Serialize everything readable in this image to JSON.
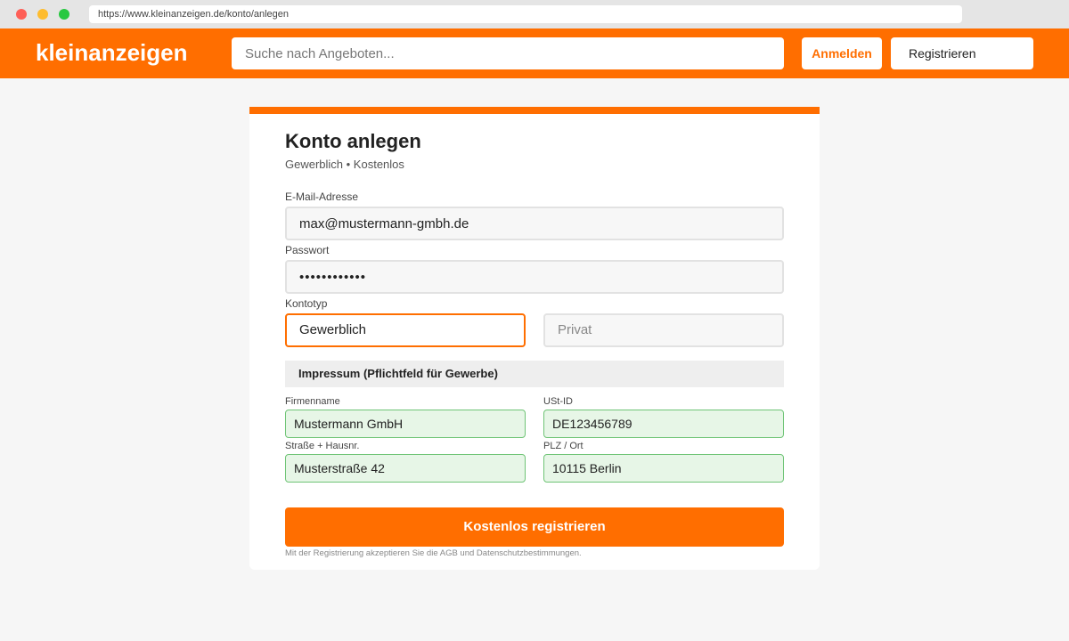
{
  "browser": {
    "url": "https://www.kleinanzeigen.de/konto/anlegen"
  },
  "header": {
    "logo": "kleinanzeigen",
    "search_placeholder": "Suche nach Angeboten...",
    "login_label": "Anmelden",
    "register_label": "Registrieren",
    "brand_color": "#ff6e00"
  },
  "form": {
    "title": "Konto anlegen",
    "subtitle": "Gewerblich • Kostenlos",
    "email": {
      "label": "E-Mail-Adresse",
      "value": "max@mustermann-gmbh.de"
    },
    "password": {
      "label": "Passwort",
      "value": "••••••••••••"
    },
    "account_type": {
      "label": "Kontotyp",
      "options": [
        "Gewerblich",
        "Privat"
      ],
      "selected": "Gewerblich"
    },
    "imprint": {
      "heading": "Impressum (Pflichtfeld für Gewerbe)",
      "company": {
        "label": "Firmenname",
        "value": "Mustermann GmbH"
      },
      "vat": {
        "label": "USt-ID",
        "value": "DE123456789"
      },
      "street": {
        "label": "Straße + Hausnr.",
        "value": "Musterstraße 42"
      },
      "city": {
        "label": "PLZ / Ort",
        "value": "10115 Berlin"
      }
    },
    "submit_label": "Kostenlos registrieren",
    "legal_text": "Mit der Registrierung akzeptieren Sie die AGB und Datenschutzbestimmungen."
  }
}
